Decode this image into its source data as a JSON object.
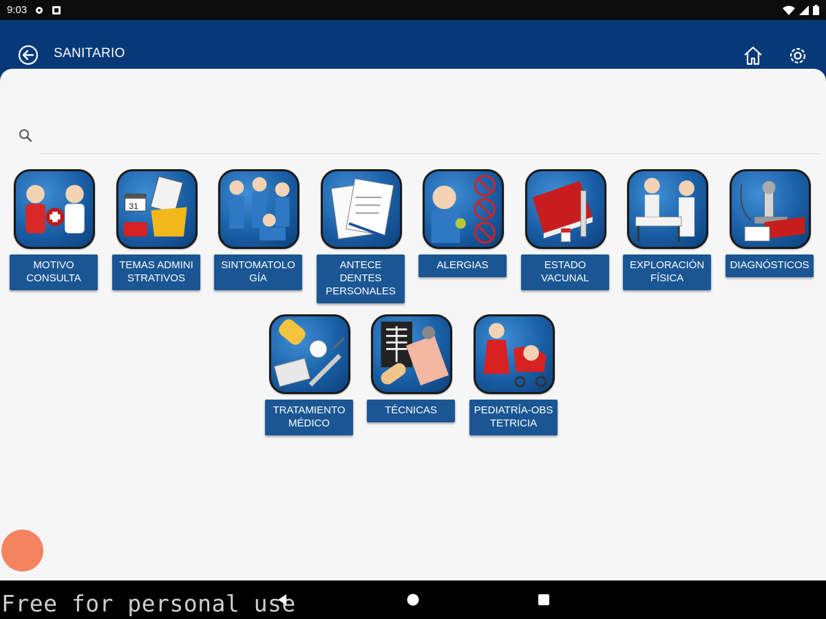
{
  "status_bar": {
    "time": "9:03"
  },
  "app_bar": {
    "title": "SANITARIO"
  },
  "search": {
    "placeholder": ""
  },
  "tiles": [
    {
      "label": "MOTIVO\nCONSULTA",
      "icon": "consultation-icon"
    },
    {
      "label": "TEMAS ADMINI\nSTRATIVOS",
      "icon": "administrative-icon"
    },
    {
      "label": "SINTOMATOLO\nGÍA",
      "icon": "symptoms-icon"
    },
    {
      "label": "ANTECE\nDENTES\nPERSONALES",
      "icon": "personal-history-icon"
    },
    {
      "label": "ALERGIAS",
      "icon": "allergies-icon"
    },
    {
      "label": "ESTADO\nVACUNAL",
      "icon": "vaccination-icon"
    },
    {
      "label": "EXPLORACIÓN\nFÍSICA",
      "icon": "physical-exam-icon"
    },
    {
      "label": "DIAGNÓSTICOS",
      "icon": "diagnostics-icon"
    },
    {
      "label": "TRATAMIENTO\nMÉDICO",
      "icon": "treatment-icon"
    },
    {
      "label": "TÉCNICAS",
      "icon": "techniques-icon"
    },
    {
      "label": "PEDIATRÍA-OBS\nTETRICIA",
      "icon": "pediatrics-icon"
    }
  ],
  "watermark": "Free for personal use",
  "colors": {
    "app_bar": "#073978",
    "label_bg": "#1a5693",
    "fab": "#f4845f"
  }
}
